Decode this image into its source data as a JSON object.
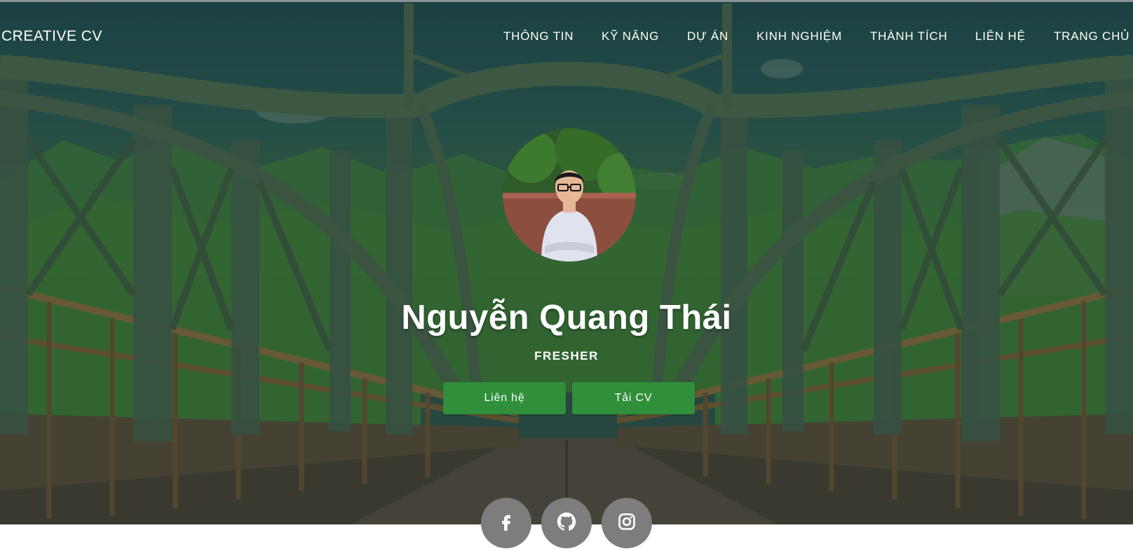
{
  "brand": "CREATIVE CV",
  "nav": [
    {
      "label": "THÔNG TIN"
    },
    {
      "label": "KỸ NĂNG"
    },
    {
      "label": "DỰ ÁN"
    },
    {
      "label": "KINH NGHIỆM"
    },
    {
      "label": "THÀNH TÍCH"
    },
    {
      "label": "LIÊN HỆ"
    },
    {
      "label": "TRANG CHỦ"
    }
  ],
  "profile": {
    "name": "Nguyễn Quang Thái",
    "role": "FRESHER"
  },
  "actions": {
    "contact_label": "Liên hệ",
    "download_label": "Tải CV"
  },
  "social": [
    {
      "icon": "facebook-icon"
    },
    {
      "icon": "github-icon"
    },
    {
      "icon": "instagram-icon"
    }
  ],
  "colors": {
    "button": "#2f8f3b",
    "social_bg": "#7d7d7d",
    "text": "#ffffff"
  }
}
